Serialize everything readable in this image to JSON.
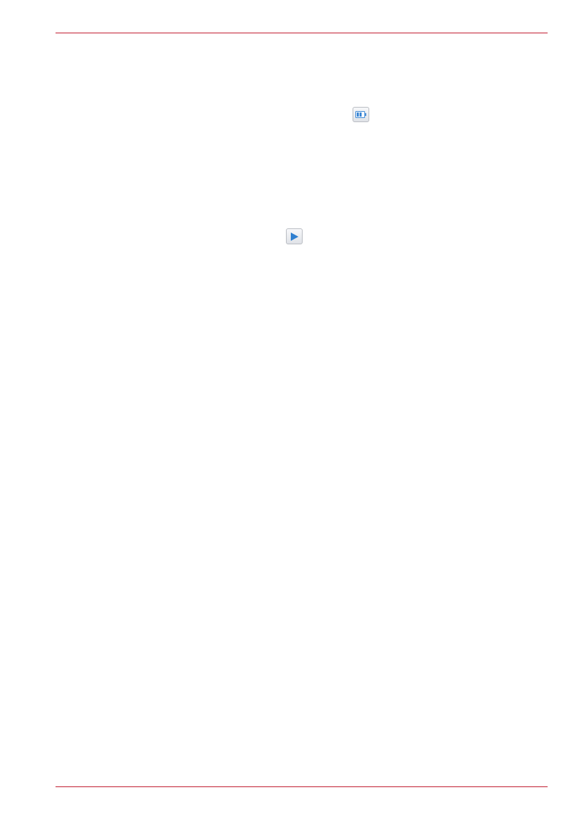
{
  "page": {
    "accent_color": "#c0182c"
  },
  "icons": [
    {
      "name": "battery-icon",
      "color": "#3a86d4"
    },
    {
      "name": "play-icon",
      "color": "#2f7fd0"
    }
  ]
}
